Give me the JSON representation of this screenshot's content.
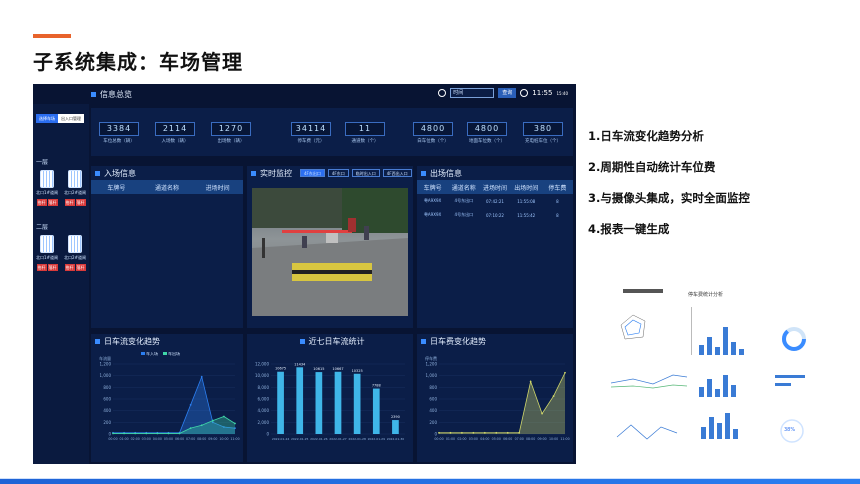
{
  "slide": {
    "title": "子系统集成：车场管理",
    "colors": {
      "accent": "#e8632b",
      "brand_blue": "#2b7ef0",
      "dash_bg": "#081433"
    }
  },
  "dashboard": {
    "info_overview_title": "信息总览",
    "time": "11:55",
    "time_suffix": "15:40",
    "time_input": "时间",
    "time_button": "查询",
    "left": {
      "tabs": [
        "选择车场",
        "出入口管理"
      ],
      "floors": [
        {
          "label": "一层",
          "gates": [
            {
              "name": "北口1#道闸",
              "buttons": [
                "抬杆",
                "落杆"
              ]
            },
            {
              "name": "北口2#道闸",
              "buttons": [
                "抬杆",
                "落杆"
              ]
            }
          ]
        },
        {
          "label": "二层",
          "gates": [
            {
              "name": "北口1#道闸",
              "buttons": [
                "抬杆",
                "落杆"
              ]
            },
            {
              "name": "北口2#道闸",
              "buttons": [
                "抬杆",
                "落杆"
              ]
            }
          ]
        }
      ]
    },
    "stats": [
      {
        "value": "3384",
        "label": "车位总数（辆）"
      },
      {
        "value": "2114",
        "label": "入场数（辆）"
      },
      {
        "value": "1270",
        "label": "出场数（辆）"
      },
      {
        "value": "34114",
        "label": "停车费（元）"
      },
      {
        "value": "11",
        "label": "通道数（个）"
      },
      {
        "value": "4800",
        "label": "白车位数（个）"
      },
      {
        "value": "4800",
        "label": "地面车位数（个）"
      },
      {
        "value": "380",
        "label": "充电桩车位（个）"
      }
    ],
    "entry": {
      "title": "入场信息",
      "columns": [
        "车牌号",
        "通道名称",
        "进场时间"
      ]
    },
    "monitor": {
      "title": "实时监控",
      "tabs": [
        "4F东出口",
        "4F东口",
        "临时出入口",
        "4F西出入口"
      ]
    },
    "exit": {
      "title": "出场信息",
      "columns": [
        "车牌号",
        "通道名称",
        "进场时间",
        "出场时间",
        "停车费"
      ],
      "rows": [
        [
          "粤A9X9X",
          "4号东出口",
          "07:42:21",
          "11:55:08",
          "8"
        ],
        [
          "粤A9X9X",
          "4号东出口",
          "07:10:22",
          "11:55:42",
          "8"
        ]
      ]
    },
    "flow_chart_title": "日车流变化趋势",
    "week_chart_title": "近七日车流统计",
    "fee_chart_title": "日车费变化趋势"
  },
  "chart_data": [
    {
      "type": "area",
      "title": "日车流变化趋势",
      "ylabel": "车流量",
      "y_ticks": [
        "0",
        "200",
        "400",
        "600",
        "800",
        "1,000",
        "1,200"
      ],
      "ylim": [
        0,
        1200
      ],
      "x": [
        "00:00",
        "01:00",
        "02:00",
        "03:00",
        "04:00",
        "05:00",
        "06:00",
        "07:00",
        "08:00",
        "09:00",
        "10:00",
        "11:00"
      ],
      "series": [
        {
          "name": "车入场",
          "values": [
            20,
            20,
            20,
            20,
            20,
            20,
            20,
            500,
            980,
            200,
            120,
            100
          ]
        },
        {
          "name": "车出场",
          "values": [
            10,
            10,
            10,
            10,
            10,
            10,
            10,
            100,
            150,
            230,
            300,
            180
          ]
        }
      ],
      "legend": "top-center"
    },
    {
      "type": "bar",
      "title": "近七日车流统计",
      "y_ticks": [
        "0",
        "2,000",
        "4,000",
        "6,000",
        "8,000",
        "10,000",
        "12,000"
      ],
      "ylim": [
        0,
        12000
      ],
      "categories": [
        "2022-01-24",
        "2022-01-25",
        "2022-01-26",
        "2022-01-27",
        "2022-01-28",
        "2022-01-29",
        "2022-01-30"
      ],
      "values": [
        10675,
        11434,
        10615,
        10667,
        10325,
        7788,
        2390
      ],
      "data_labels": [
        "10675",
        "11434",
        "10615",
        "10667",
        "10325",
        "7788",
        "2390"
      ]
    },
    {
      "type": "area",
      "title": "日车费变化趋势",
      "ylabel": "停车费",
      "y_ticks": [
        "0",
        "200",
        "400",
        "600",
        "800",
        "1,000",
        "1,200"
      ],
      "ylim": [
        0,
        1200
      ],
      "x": [
        "00:00",
        "01:00",
        "02:00",
        "03:00",
        "04:00",
        "05:00",
        "06:00",
        "07:00",
        "08:00",
        "09:00",
        "10:00",
        "11:00"
      ],
      "series": [
        {
          "name": "",
          "values": [
            20,
            20,
            20,
            20,
            20,
            20,
            20,
            20,
            900,
            350,
            650,
            1050
          ]
        }
      ]
    }
  ],
  "bullets": [
    "1.日车流变化趋势分析",
    "2.周期性自动统计车位费",
    "3.与摄像头集成，实时全面监控",
    "4.报表一键生成"
  ],
  "thumbnail": {
    "title": "停车费统计分析",
    "donut_label": "38%"
  }
}
